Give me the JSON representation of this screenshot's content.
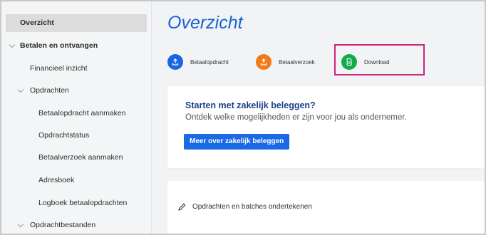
{
  "sidebar": {
    "items": [
      {
        "label": "Overzicht"
      },
      {
        "label": "Betalen en ontvangen"
      },
      {
        "label": "Financieel inzicht"
      },
      {
        "label": "Opdrachten"
      },
      {
        "label": "Betaalopdracht aanmaken"
      },
      {
        "label": "Opdrachtstatus"
      },
      {
        "label": "Betaalverzoek aanmaken"
      },
      {
        "label": "Adresboek"
      },
      {
        "label": "Logboek betaalopdrachten"
      },
      {
        "label": "Opdrachtbestanden"
      }
    ]
  },
  "main": {
    "title": "Overzicht",
    "actions": [
      {
        "label": "Betaalopdracht",
        "icon": "upload-icon",
        "color": "#1a66e0"
      },
      {
        "label": "Betaalverzoek",
        "icon": "upload-icon",
        "color": "#f07a1a"
      },
      {
        "label": "Download",
        "icon": "document-icon",
        "color": "#16a94b"
      }
    ],
    "promo": {
      "title": "Starten met zakelijk beleggen?",
      "text": "Ontdek welke mogelijkheden er zijn voor jou als ondernemer.",
      "button": "Meer over zakelijk beleggen"
    },
    "sign": {
      "label": "Opdrachten en batches ondertekenen",
      "icon": "pencil-icon"
    }
  },
  "colors": {
    "accent": "#1762d6",
    "highlight": "#c8287e"
  }
}
